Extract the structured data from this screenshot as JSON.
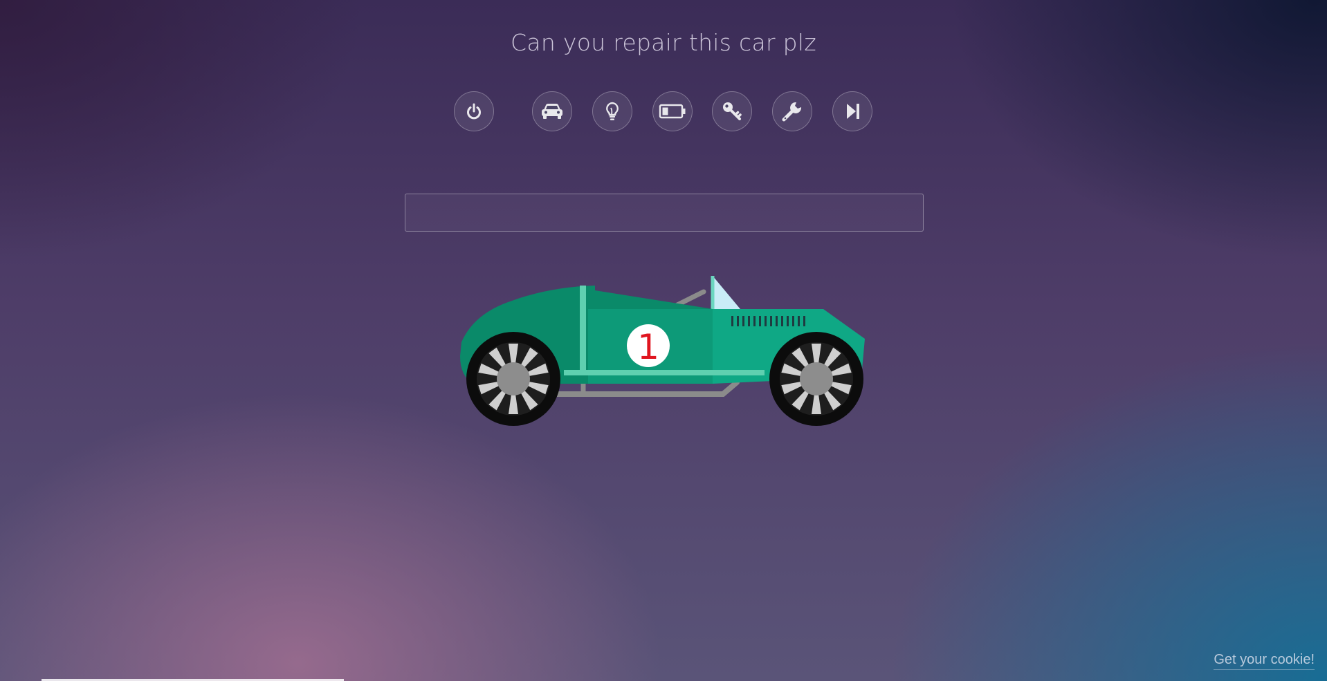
{
  "page": {
    "title": "Can you repair this car plz"
  },
  "toolbar": {
    "buttons": [
      {
        "icon": "power-icon"
      },
      {
        "icon": "car-icon"
      },
      {
        "icon": "lightbulb-icon"
      },
      {
        "icon": "battery-icon"
      },
      {
        "icon": "key-icon"
      },
      {
        "icon": "wrench-icon"
      },
      {
        "icon": "skip-forward-icon"
      }
    ]
  },
  "answer": {
    "value": "",
    "placeholder": ""
  },
  "car": {
    "race_number": "1",
    "body_color": "#0e9a78",
    "accent_color": "#5fd0b0",
    "number_color": "#e0151f"
  },
  "footer": {
    "cookie_link": "Get your cookie!"
  },
  "progress": {
    "value": 0.19
  }
}
